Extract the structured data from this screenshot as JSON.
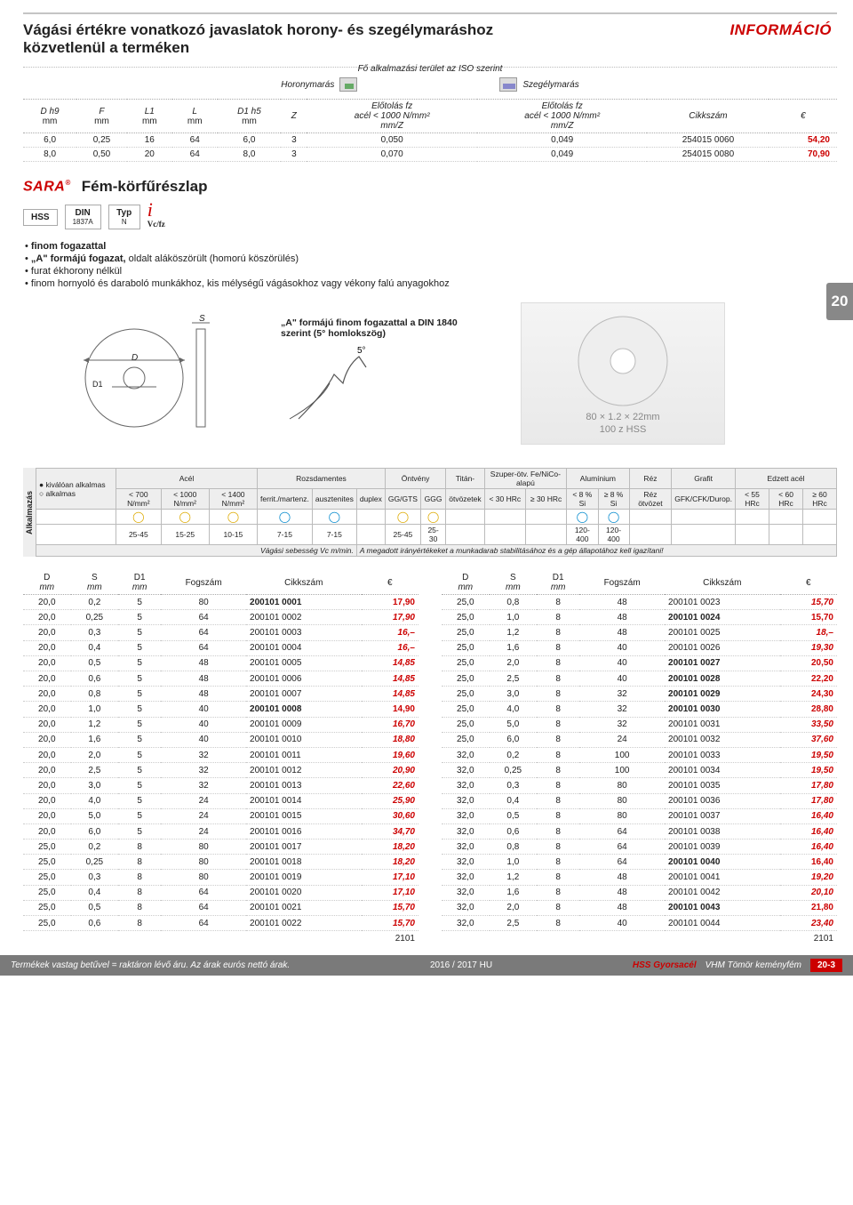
{
  "header": {
    "title": "Vágási értékre vonatkozó javaslatok horony- és szegélymaráshoz közvetlenül a terméken",
    "info": "INFORMÁCIÓ",
    "iso_line": "Fő alkalmazási terület az ISO szerint",
    "app1": "Horonymarás",
    "app2": "Szegélymarás"
  },
  "t1": {
    "cols": [
      "D h9",
      "F",
      "L1",
      "L",
      "D1 h5",
      "Z",
      "Előtolás fz\nacél < 1000 N/mm²\nmm/Z",
      "Előtolás fz\nacél < 1000 N/mm²\nmm/Z",
      "Cikkszám",
      "€"
    ],
    "rows": [
      [
        "6,0",
        "0,25",
        "16",
        "64",
        "6,0",
        "3",
        "0,050",
        "0,049",
        "254015 0060",
        "54,20"
      ],
      [
        "8,0",
        "0,50",
        "20",
        "64",
        "8,0",
        "3",
        "0,070",
        "0,049",
        "254015 0080",
        "70,90"
      ]
    ]
  },
  "sara": {
    "logo": "SARA",
    "name": "Fém-körfűrészlap",
    "tab": "20",
    "badges": {
      "b1": {
        "t": "HSS",
        "s": ""
      },
      "b2": {
        "t": "DIN",
        "s": "1837A"
      },
      "b3": {
        "t": "Typ",
        "s": "N"
      },
      "i": {
        "sym": "i",
        "sub": "Vc/fz"
      }
    },
    "bullets": [
      "<strong>finom fogazattal</strong>",
      "<strong>„A\" formájú fogazat,</strong> oldalt aláköszörült (homorú köszörülés)",
      "furat ékhorony nélkül",
      "finom hornyoló és daraboló munkákhoz, kis mélységű vágásokhoz vagy vékony falú anyagokhoz"
    ],
    "teeth_caption": "„A\" formájú finom fogazattal a DIN 1840 szerint (5° homlokszög)",
    "photo_lines": [
      "80 × 1.2 × 22mm",
      "100 z   HSS"
    ]
  },
  "matrix": {
    "side": "Alkalmazás",
    "legend": [
      "● kiválóan alkalmas",
      "○ alkalmas"
    ],
    "groups": [
      "Acél",
      "",
      "",
      "Rozsdamentes",
      "",
      "",
      "Öntvény",
      "",
      "Titán-",
      "Szuper-ötv. Fe/NiCo-alapú",
      "",
      "Alumínium",
      "",
      "Réz",
      "Grafit",
      "Edzett acél",
      "",
      ""
    ],
    "subcols": [
      "< 700 N/mm²",
      "< 1000 N/mm²",
      "< 1400 N/mm²",
      "ferrit./martenz.",
      "ausztenites",
      "duplex",
      "GG/GTS",
      "GGG",
      "ötvözetek",
      "< 30 HRc",
      "≥ 30 HRc",
      "< 8 % Si",
      "≥ 8 % Si",
      "Réz ötvözet",
      "GFK/CFK/Durop.",
      "< 55 HRc",
      "< 60 HRc",
      "≥ 60 HRc"
    ],
    "marks": [
      "y",
      "y",
      "y",
      "b",
      "b",
      "",
      "y",
      "y",
      "",
      "",
      "",
      "b",
      "b",
      "",
      "",
      "",
      "",
      ""
    ],
    "vals": [
      "25-45",
      "15-25",
      "10-15",
      "7-15",
      "7-15",
      "",
      "25-45",
      "25-30",
      "",
      "",
      "",
      "120-400",
      "120-400",
      "",
      "",
      "",
      "",
      ""
    ],
    "note_left": "Vágási sebesség Vc m/min.",
    "note_right": "A megadott irányértékeket a munkadarab stabilitásához és a gép állapotához kell igazítani!"
  },
  "prod": {
    "cols": [
      "D",
      "S",
      "D1",
      "Fogszám",
      "Cikkszám",
      "€"
    ],
    "units": [
      "mm",
      "mm",
      "mm",
      "",
      "",
      ""
    ],
    "left_rows": [
      [
        "20,0",
        "0,2",
        "5",
        "80",
        "200101 0001",
        "17,90",
        1
      ],
      [
        "20,0",
        "0,25",
        "5",
        "64",
        "200101 0002",
        "17,90",
        0
      ],
      [
        "20,0",
        "0,3",
        "5",
        "64",
        "200101 0003",
        "16,–",
        0
      ],
      [
        "20,0",
        "0,4",
        "5",
        "64",
        "200101 0004",
        "16,–",
        0
      ],
      [
        "20,0",
        "0,5",
        "5",
        "48",
        "200101 0005",
        "14,85",
        0
      ],
      [
        "20,0",
        "0,6",
        "5",
        "48",
        "200101 0006",
        "14,85",
        0
      ],
      [
        "20,0",
        "0,8",
        "5",
        "48",
        "200101 0007",
        "14,85",
        0
      ],
      [
        "20,0",
        "1,0",
        "5",
        "40",
        "200101 0008",
        "14,90",
        1
      ],
      [
        "20,0",
        "1,2",
        "5",
        "40",
        "200101 0009",
        "16,70",
        0
      ],
      [
        "20,0",
        "1,6",
        "5",
        "40",
        "200101 0010",
        "18,80",
        0
      ],
      [
        "20,0",
        "2,0",
        "5",
        "32",
        "200101 0011",
        "19,60",
        0
      ],
      [
        "20,0",
        "2,5",
        "5",
        "32",
        "200101 0012",
        "20,90",
        0
      ],
      [
        "20,0",
        "3,0",
        "5",
        "32",
        "200101 0013",
        "22,60",
        0
      ],
      [
        "20,0",
        "4,0",
        "5",
        "24",
        "200101 0014",
        "25,90",
        0
      ],
      [
        "20,0",
        "5,0",
        "5",
        "24",
        "200101 0015",
        "30,60",
        0
      ],
      [
        "20,0",
        "6,0",
        "5",
        "24",
        "200101 0016",
        "34,70",
        0
      ],
      [
        "25,0",
        "0,2",
        "8",
        "80",
        "200101 0017",
        "18,20",
        0
      ],
      [
        "25,0",
        "0,25",
        "8",
        "80",
        "200101 0018",
        "18,20",
        0
      ],
      [
        "25,0",
        "0,3",
        "8",
        "80",
        "200101 0019",
        "17,10",
        0
      ],
      [
        "25,0",
        "0,4",
        "8",
        "64",
        "200101 0020",
        "17,10",
        0
      ],
      [
        "25,0",
        "0,5",
        "8",
        "64",
        "200101 0021",
        "15,70",
        0
      ],
      [
        "25,0",
        "0,6",
        "8",
        "64",
        "200101 0022",
        "15,70",
        0
      ]
    ],
    "left_total": "2101",
    "right_rows": [
      [
        "25,0",
        "0,8",
        "8",
        "48",
        "200101 0023",
        "15,70",
        0
      ],
      [
        "25,0",
        "1,0",
        "8",
        "48",
        "200101 0024",
        "15,70",
        1
      ],
      [
        "25,0",
        "1,2",
        "8",
        "48",
        "200101 0025",
        "18,–",
        0
      ],
      [
        "25,0",
        "1,6",
        "8",
        "40",
        "200101 0026",
        "19,30",
        0
      ],
      [
        "25,0",
        "2,0",
        "8",
        "40",
        "200101 0027",
        "20,50",
        1
      ],
      [
        "25,0",
        "2,5",
        "8",
        "40",
        "200101 0028",
        "22,20",
        1
      ],
      [
        "25,0",
        "3,0",
        "8",
        "32",
        "200101 0029",
        "24,30",
        1
      ],
      [
        "25,0",
        "4,0",
        "8",
        "32",
        "200101 0030",
        "28,80",
        1
      ],
      [
        "25,0",
        "5,0",
        "8",
        "32",
        "200101 0031",
        "33,50",
        0
      ],
      [
        "25,0",
        "6,0",
        "8",
        "24",
        "200101 0032",
        "37,60",
        0
      ],
      [
        "32,0",
        "0,2",
        "8",
        "100",
        "200101 0033",
        "19,50",
        0
      ],
      [
        "32,0",
        "0,25",
        "8",
        "100",
        "200101 0034",
        "19,50",
        0
      ],
      [
        "32,0",
        "0,3",
        "8",
        "80",
        "200101 0035",
        "17,80",
        0
      ],
      [
        "32,0",
        "0,4",
        "8",
        "80",
        "200101 0036",
        "17,80",
        0
      ],
      [
        "32,0",
        "0,5",
        "8",
        "80",
        "200101 0037",
        "16,40",
        0
      ],
      [
        "32,0",
        "0,6",
        "8",
        "64",
        "200101 0038",
        "16,40",
        0
      ],
      [
        "32,0",
        "0,8",
        "8",
        "64",
        "200101 0039",
        "16,40",
        0
      ],
      [
        "32,0",
        "1,0",
        "8",
        "64",
        "200101 0040",
        "16,40",
        1
      ],
      [
        "32,0",
        "1,2",
        "8",
        "48",
        "200101 0041",
        "19,20",
        0
      ],
      [
        "32,0",
        "1,6",
        "8",
        "48",
        "200101 0042",
        "20,10",
        0
      ],
      [
        "32,0",
        "2,0",
        "8",
        "48",
        "200101 0043",
        "21,80",
        1
      ],
      [
        "32,0",
        "2,5",
        "8",
        "40",
        "200101 0044",
        "23,40",
        0
      ]
    ],
    "right_total": "2101"
  },
  "footer": {
    "left": "Termékek vastag betűvel = raktáron lévő áru.    Az árak eurós nettó árak.",
    "mid": "2016 / 2017 HU",
    "hss": "HSS Gyorsacél",
    "vhm": "VHM Tömör keményfém",
    "page": "20-3"
  }
}
